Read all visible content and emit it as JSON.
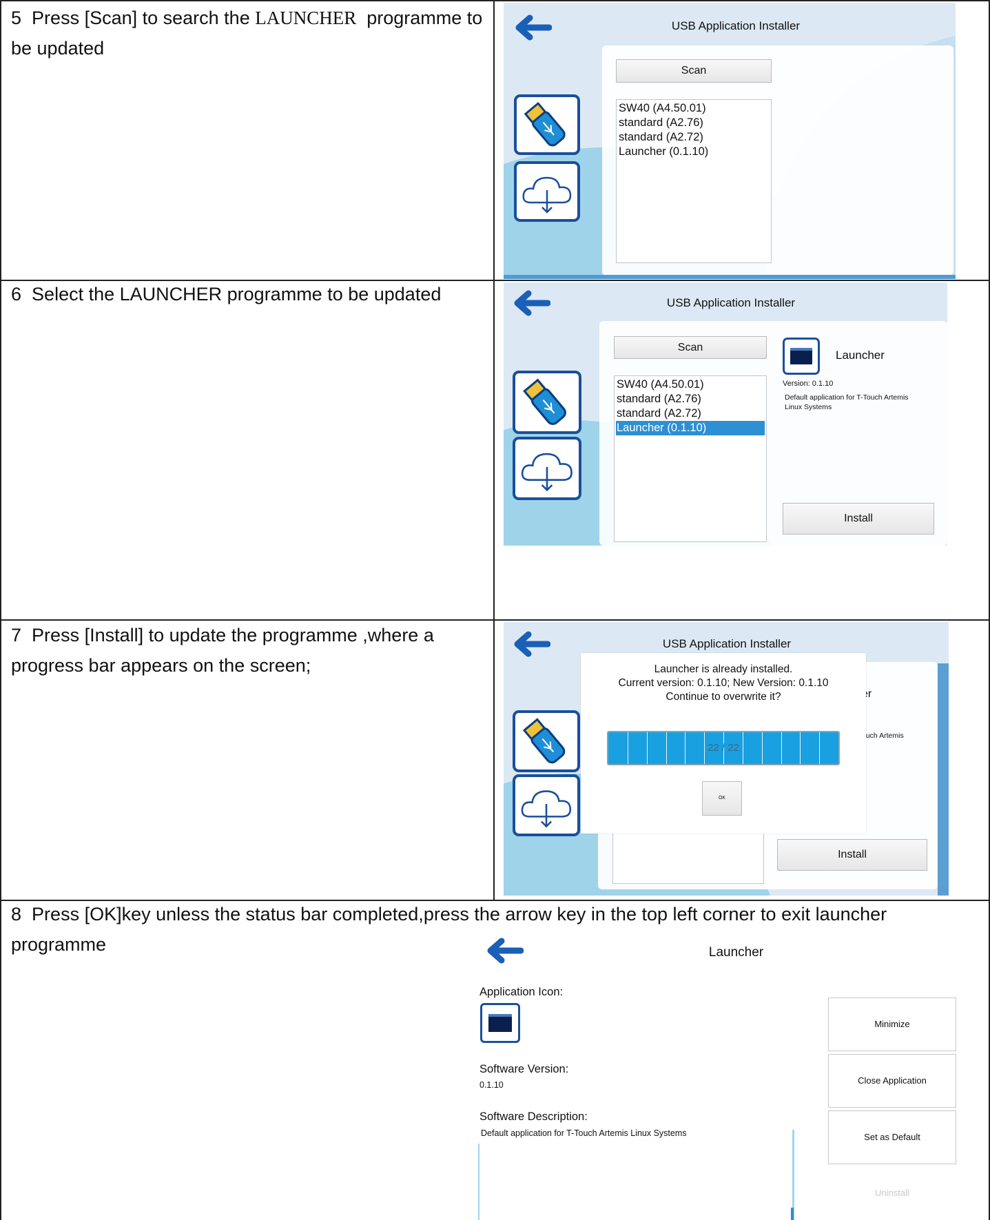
{
  "rows": [
    {
      "step": "5",
      "text_before": "Press [Scan] to search the",
      "text_launcher": "LAUNCHER",
      "text_after": "programme to be updated",
      "screen": {
        "title": "USB Application Installer",
        "scan_label": "Scan",
        "list": [
          "SW40 (A4.50.01)",
          "standard (A2.76)",
          "standard (A2.72)",
          "Launcher (0.1.10)"
        ]
      }
    },
    {
      "step": "6",
      "text": "Select the LAUNCHER programme to be updated",
      "screen": {
        "title": "USB Application Installer",
        "scan_label": "Scan",
        "list": [
          "SW40 (A4.50.01)",
          "standard (A2.76)",
          "standard (A2.72)",
          "Launcher (0.1.10)"
        ],
        "selected_index": 3,
        "app_name": "Launcher",
        "version": "Version: 0.1.10",
        "description": "Default application for T-Touch Artemis Linux Systems",
        "install_label": "Install"
      }
    },
    {
      "step": "7",
      "text": "Press [Install] to update the programme ,where a progress bar appears on the screen;",
      "screen": {
        "title": "USB Application Installer",
        "dialog_line1": "Launcher is already installed.",
        "dialog_line2": "Current version: 0.1.10; New Version: 0.1.10",
        "dialog_line3": "Continue to overwrite it?",
        "progress_text": "22 / 22",
        "progress_fraction": 1.0,
        "ok_label": "OK",
        "peek_er": "er",
        "peek_desc": "ouch Artemis",
        "install_label": "Install"
      }
    },
    {
      "step": "8",
      "text": "Press [OK]key unless the status bar completed,press the arrow key in the top left corner to exit launcher programme",
      "screen": {
        "title": "Launcher",
        "app_icon_label": "Application Icon:",
        "version_label": "Software Version:",
        "version_value": "0.1.10",
        "desc_label": "Software Description:",
        "desc_value": "Default application for T-Touch Artemis Linux Systems",
        "buttons": [
          "Minimize",
          "Close Application",
          "Set as Default",
          "Uninstall"
        ]
      }
    }
  ],
  "colors": {
    "accent": "#1a6fc4",
    "selection": "#2d8fd4",
    "progress": "#19a0e0"
  }
}
